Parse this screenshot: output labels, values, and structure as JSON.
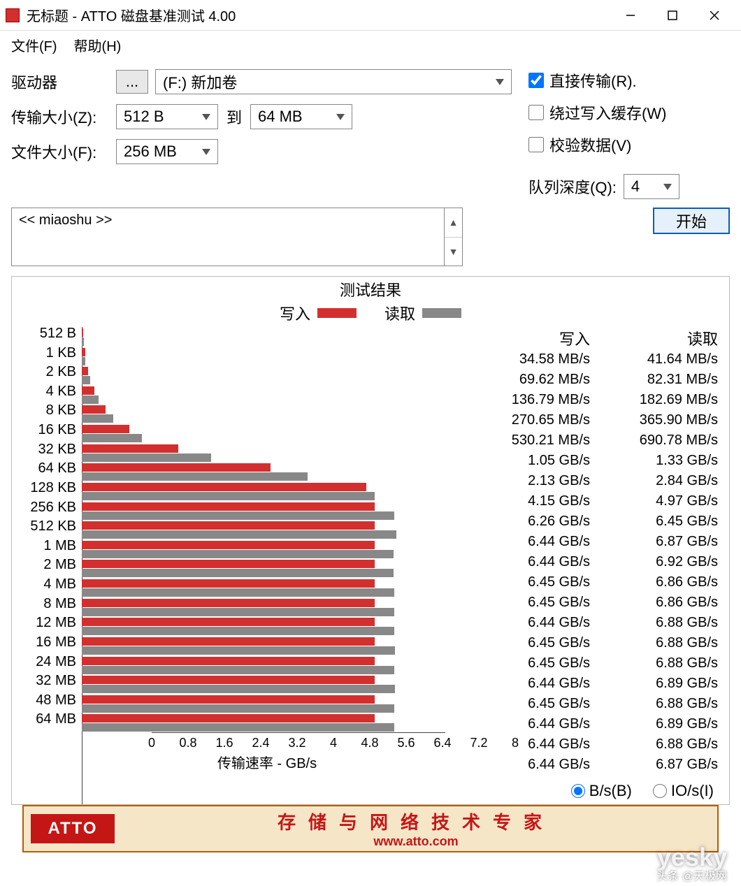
{
  "window": {
    "title": "无标题 - ATTO 磁盘基准测试 4.00"
  },
  "menu": {
    "file": "文件(F)",
    "help": "帮助(H)"
  },
  "labels": {
    "drive": "驱动器",
    "browse": "...",
    "drive_value": "(F:) 新加卷",
    "xfer_size": "传输大小(Z):",
    "xfer_from": "512 B",
    "to": "到",
    "xfer_to": "64 MB",
    "file_size": "文件大小(F):",
    "file_size_value": "256 MB",
    "direct_io": "直接传输(R).",
    "bypass_cache": "绕过写入缓存(W)",
    "verify": "校验数据(V)",
    "queue_depth": "队列深度(Q):",
    "queue_depth_value": "4",
    "description": "<< miaoshu >>",
    "start": "开始",
    "results_title": "测试结果",
    "write": "写入",
    "read": "读取",
    "xfer_rate_axis": "传输速率 - GB/s",
    "unit_bytes": "B/s(B)",
    "unit_io": "IO/s(I)"
  },
  "footer": {
    "logo": "ATTO",
    "line1": "存储与网络技术专家",
    "line2": "www.atto.com"
  },
  "watermark": {
    "main": "yesky",
    "sub": "头条 @天极网"
  },
  "chart_data": {
    "type": "bar",
    "title": "测试结果",
    "xlabel": "传输速率 - GB/s",
    "ylabel": "",
    "x_ticks": [
      "0",
      "0.8",
      "1.6",
      "2.4",
      "3.2",
      "4",
      "4.8",
      "5.6",
      "6.4",
      "7.2",
      "8"
    ],
    "xlim": [
      0,
      8
    ],
    "categories": [
      "512 B",
      "1 KB",
      "2 KB",
      "4 KB",
      "8 KB",
      "16 KB",
      "32 KB",
      "64 KB",
      "128 KB",
      "256 KB",
      "512 KB",
      "1 MB",
      "2 MB",
      "4 MB",
      "8 MB",
      "12 MB",
      "16 MB",
      "24 MB",
      "32 MB",
      "48 MB",
      "64 MB"
    ],
    "series": [
      {
        "name": "写入",
        "color": "#d32f2f",
        "values": [
          0.03458,
          0.06962,
          0.13679,
          0.27065,
          0.53021,
          1.05,
          2.13,
          4.15,
          6.26,
          6.44,
          6.44,
          6.45,
          6.45,
          6.44,
          6.45,
          6.45,
          6.44,
          6.45,
          6.44,
          6.44,
          6.44
        ]
      },
      {
        "name": "读取",
        "color": "#888",
        "values": [
          0.04164,
          0.08231,
          0.18269,
          0.3659,
          0.69078,
          1.33,
          2.84,
          4.97,
          6.45,
          6.87,
          6.92,
          6.86,
          6.86,
          6.88,
          6.88,
          6.88,
          6.89,
          6.88,
          6.89,
          6.88,
          6.87
        ]
      }
    ],
    "display_table": [
      {
        "size": "512 B",
        "write": "34.58 MB/s",
        "read": "41.64 MB/s"
      },
      {
        "size": "1 KB",
        "write": "69.62 MB/s",
        "read": "82.31 MB/s"
      },
      {
        "size": "2 KB",
        "write": "136.79 MB/s",
        "read": "182.69 MB/s"
      },
      {
        "size": "4 KB",
        "write": "270.65 MB/s",
        "read": "365.90 MB/s"
      },
      {
        "size": "8 KB",
        "write": "530.21 MB/s",
        "read": "690.78 MB/s"
      },
      {
        "size": "16 KB",
        "write": "1.05 GB/s",
        "read": "1.33 GB/s"
      },
      {
        "size": "32 KB",
        "write": "2.13 GB/s",
        "read": "2.84 GB/s"
      },
      {
        "size": "64 KB",
        "write": "4.15 GB/s",
        "read": "4.97 GB/s"
      },
      {
        "size": "128 KB",
        "write": "6.26 GB/s",
        "read": "6.45 GB/s"
      },
      {
        "size": "256 KB",
        "write": "6.44 GB/s",
        "read": "6.87 GB/s"
      },
      {
        "size": "512 KB",
        "write": "6.44 GB/s",
        "read": "6.92 GB/s"
      },
      {
        "size": "1 MB",
        "write": "6.45 GB/s",
        "read": "6.86 GB/s"
      },
      {
        "size": "2 MB",
        "write": "6.45 GB/s",
        "read": "6.86 GB/s"
      },
      {
        "size": "4 MB",
        "write": "6.44 GB/s",
        "read": "6.88 GB/s"
      },
      {
        "size": "8 MB",
        "write": "6.45 GB/s",
        "read": "6.88 GB/s"
      },
      {
        "size": "12 MB",
        "write": "6.45 GB/s",
        "read": "6.88 GB/s"
      },
      {
        "size": "16 MB",
        "write": "6.44 GB/s",
        "read": "6.89 GB/s"
      },
      {
        "size": "24 MB",
        "write": "6.45 GB/s",
        "read": "6.88 GB/s"
      },
      {
        "size": "32 MB",
        "write": "6.44 GB/s",
        "read": "6.89 GB/s"
      },
      {
        "size": "48 MB",
        "write": "6.44 GB/s",
        "read": "6.88 GB/s"
      },
      {
        "size": "64 MB",
        "write": "6.44 GB/s",
        "read": "6.87 GB/s"
      }
    ]
  }
}
